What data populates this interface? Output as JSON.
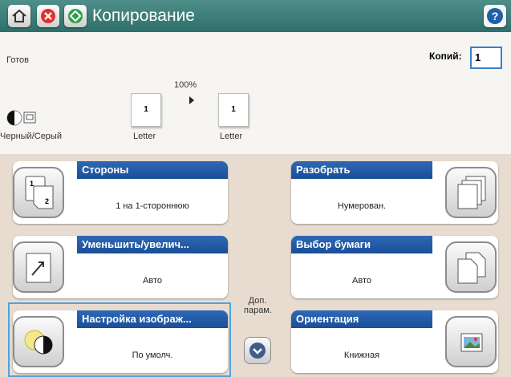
{
  "header": {
    "title": "Копирование",
    "home_icon": "home-icon",
    "stop_icon": "stop-icon",
    "start_icon": "start-icon",
    "help_icon": "help-icon"
  },
  "status": {
    "text": "Готов",
    "copies_label": "Копий:",
    "copies_value": "1"
  },
  "preview": {
    "zoom": "100%",
    "color_mode": "Черный/Серый",
    "source_page": "1",
    "source_size": "Letter",
    "dest_page": "1",
    "dest_size": "Letter"
  },
  "tiles": {
    "sides": {
      "title": "Стороны",
      "value": "1 на 1-стороннюю"
    },
    "collate": {
      "title": "Разобрать",
      "value": "Нумерован."
    },
    "reduce": {
      "title": "Уменьшить/увелич...",
      "value": "Авто"
    },
    "paper": {
      "title": "Выбор бумаги",
      "value": "Авто"
    },
    "image": {
      "title": "Настройка изображ...",
      "value": "По умолч."
    },
    "orientation": {
      "title": "Ориентация",
      "value": "Книжная"
    }
  },
  "more": {
    "label_line1": "Доп.",
    "label_line2": "парам."
  },
  "colors": {
    "header": "#2f6f6b",
    "tile_header": "#1a4f98",
    "selection": "#4da3e0"
  }
}
